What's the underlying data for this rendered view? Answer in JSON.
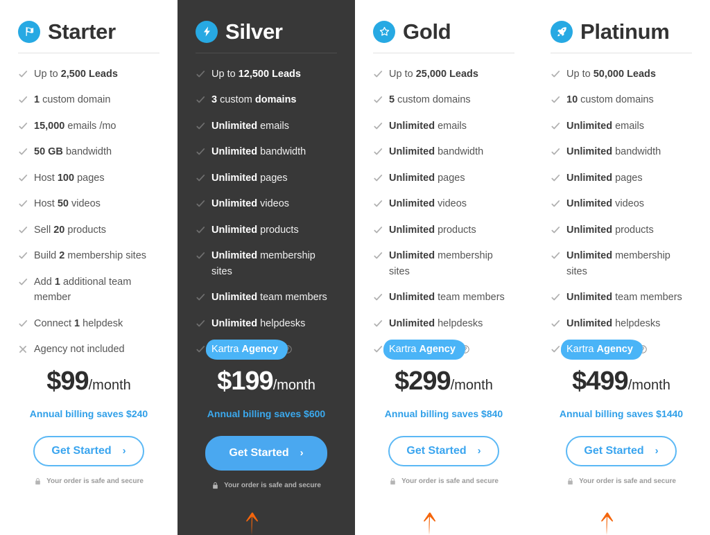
{
  "plans": [
    {
      "name": "Starter",
      "icon": "flag-icon",
      "theme": "light",
      "features": [
        {
          "pre": "Up to ",
          "strong": "2,500 Leads",
          "post": "",
          "mark": "check",
          "highlight": false
        },
        {
          "pre": "",
          "strong": "1",
          "post": " custom domain",
          "mark": "check",
          "highlight": false
        },
        {
          "pre": "",
          "strong": "15,000",
          "post": " emails /mo",
          "mark": "check",
          "highlight": false
        },
        {
          "pre": "",
          "strong": "50 GB",
          "post": " bandwidth",
          "mark": "check",
          "highlight": false
        },
        {
          "pre": "Host ",
          "strong": "100",
          "post": " pages",
          "mark": "check",
          "highlight": false
        },
        {
          "pre": "Host ",
          "strong": "50",
          "post": " videos",
          "mark": "check",
          "highlight": false
        },
        {
          "pre": "Sell ",
          "strong": "20",
          "post": " products",
          "mark": "check",
          "highlight": false
        },
        {
          "pre": "Build ",
          "strong": "2",
          "post": " membership sites",
          "mark": "check",
          "highlight": false
        },
        {
          "pre": "Add ",
          "strong": "1",
          "post": " additional team member",
          "mark": "check",
          "highlight": false
        },
        {
          "pre": "Connect ",
          "strong": "1",
          "post": " helpdesk",
          "mark": "check",
          "highlight": false
        },
        {
          "pre": "Agency not included",
          "strong": "",
          "post": "",
          "mark": "cross",
          "highlight": false
        }
      ],
      "price": "$99",
      "per": "/month",
      "annual": "Annual billing saves $240",
      "cta": "Get Started",
      "cta_style": "outline",
      "secure": "Your order is safe and secure",
      "arrow": false
    },
    {
      "name": "Silver",
      "icon": "bolt-icon",
      "theme": "dark",
      "features": [
        {
          "pre": "Up to ",
          "strong": "12,500 Leads",
          "post": "",
          "mark": "check",
          "highlight": false
        },
        {
          "pre": "",
          "strong": "3",
          "post": " custom ",
          "post_strong": "domains",
          "mark": "check",
          "highlight": false
        },
        {
          "pre": "",
          "strong": "Unlimited",
          "post": " emails",
          "mark": "check",
          "highlight": false
        },
        {
          "pre": "",
          "strong": "Unlimited",
          "post": " bandwidth",
          "mark": "check",
          "highlight": false
        },
        {
          "pre": "",
          "strong": "Unlimited",
          "post": " pages",
          "mark": "check",
          "highlight": false
        },
        {
          "pre": "",
          "strong": "Unlimited",
          "post": " videos",
          "mark": "check",
          "highlight": false
        },
        {
          "pre": "",
          "strong": "Unlimited",
          "post": " products",
          "mark": "check",
          "highlight": false
        },
        {
          "pre": "",
          "strong": "Unlimited",
          "post": " membership sites",
          "mark": "check",
          "highlight": false
        },
        {
          "pre": "",
          "strong": "Unlimited",
          "post": " team members",
          "mark": "check",
          "highlight": false
        },
        {
          "pre": "",
          "strong": "Unlimited",
          "post": " helpdesks",
          "mark": "check",
          "highlight": false
        },
        {
          "pre": "Kartra ",
          "strong": "Agency",
          "post": "",
          "mark": "check",
          "highlight": true
        }
      ],
      "price": "$199",
      "per": "/month",
      "annual": "Annual billing saves $600",
      "cta": "Get Started",
      "cta_style": "filled",
      "secure": "Your order is safe and secure",
      "arrow": true
    },
    {
      "name": "Gold",
      "icon": "star-icon",
      "theme": "light",
      "features": [
        {
          "pre": "Up to ",
          "strong": "25,000 Leads",
          "post": "",
          "mark": "check",
          "highlight": false
        },
        {
          "pre": "",
          "strong": "5",
          "post": " custom domains",
          "mark": "check",
          "highlight": false
        },
        {
          "pre": "",
          "strong": "Unlimited",
          "post": " emails",
          "mark": "check",
          "highlight": false
        },
        {
          "pre": "",
          "strong": "Unlimited",
          "post": " bandwidth",
          "mark": "check",
          "highlight": false
        },
        {
          "pre": "",
          "strong": "Unlimited",
          "post": " pages",
          "mark": "check",
          "highlight": false
        },
        {
          "pre": "",
          "strong": "Unlimited",
          "post": " videos",
          "mark": "check",
          "highlight": false
        },
        {
          "pre": "",
          "strong": "Unlimited",
          "post": " products",
          "mark": "check",
          "highlight": false
        },
        {
          "pre": "",
          "strong": "Unlimited",
          "post": " membership sites",
          "mark": "check",
          "highlight": false
        },
        {
          "pre": "",
          "strong": "Unlimited",
          "post": " team members",
          "mark": "check",
          "highlight": false
        },
        {
          "pre": "",
          "strong": "Unlimited",
          "post": " helpdesks",
          "mark": "check",
          "highlight": false
        },
        {
          "pre": "Kartra ",
          "strong": "Agency",
          "post": "",
          "mark": "check",
          "highlight": true
        }
      ],
      "price": "$299",
      "per": "/month",
      "annual": "Annual billing saves $840",
      "cta": "Get Started",
      "cta_style": "outline",
      "secure": "Your order is safe and secure",
      "arrow": true
    },
    {
      "name": "Platinum",
      "icon": "rocket-icon",
      "theme": "light",
      "features": [
        {
          "pre": "Up to ",
          "strong": "50,000 Leads",
          "post": "",
          "mark": "check",
          "highlight": false
        },
        {
          "pre": "",
          "strong": "10",
          "post": " custom domains",
          "mark": "check",
          "highlight": false
        },
        {
          "pre": "",
          "strong": "Unlimited",
          "post": " emails",
          "mark": "check",
          "highlight": false
        },
        {
          "pre": "",
          "strong": "Unlimited",
          "post": " bandwidth",
          "mark": "check",
          "highlight": false
        },
        {
          "pre": "",
          "strong": "Unlimited",
          "post": " pages",
          "mark": "check",
          "highlight": false
        },
        {
          "pre": "",
          "strong": "Unlimited",
          "post": " videos",
          "mark": "check",
          "highlight": false
        },
        {
          "pre": "",
          "strong": "Unlimited",
          "post": " products",
          "mark": "check",
          "highlight": false
        },
        {
          "pre": "",
          "strong": "Unlimited",
          "post": " membership sites",
          "mark": "check",
          "highlight": false
        },
        {
          "pre": "",
          "strong": "Unlimited",
          "post": " team members",
          "mark": "check",
          "highlight": false
        },
        {
          "pre": "",
          "strong": "Unlimited",
          "post": " helpdesks",
          "mark": "check",
          "highlight": false
        },
        {
          "pre": "Kartra ",
          "strong": "Agency",
          "post": "",
          "mark": "check",
          "highlight": true
        }
      ],
      "price": "$499",
      "per": "/month",
      "annual": "Annual billing saves $1440",
      "cta": "Get Started",
      "cta_style": "outline",
      "secure": "Your order is safe and secure",
      "arrow": true
    }
  ],
  "colors": {
    "accent": "#27a9e3",
    "accent_light": "#4ab4f7",
    "dark_bg": "#383838",
    "arrow": "#f4650c",
    "check": "#b0b0b0",
    "check_dark": "#6f6f6f"
  },
  "chevron_glyph": "›"
}
